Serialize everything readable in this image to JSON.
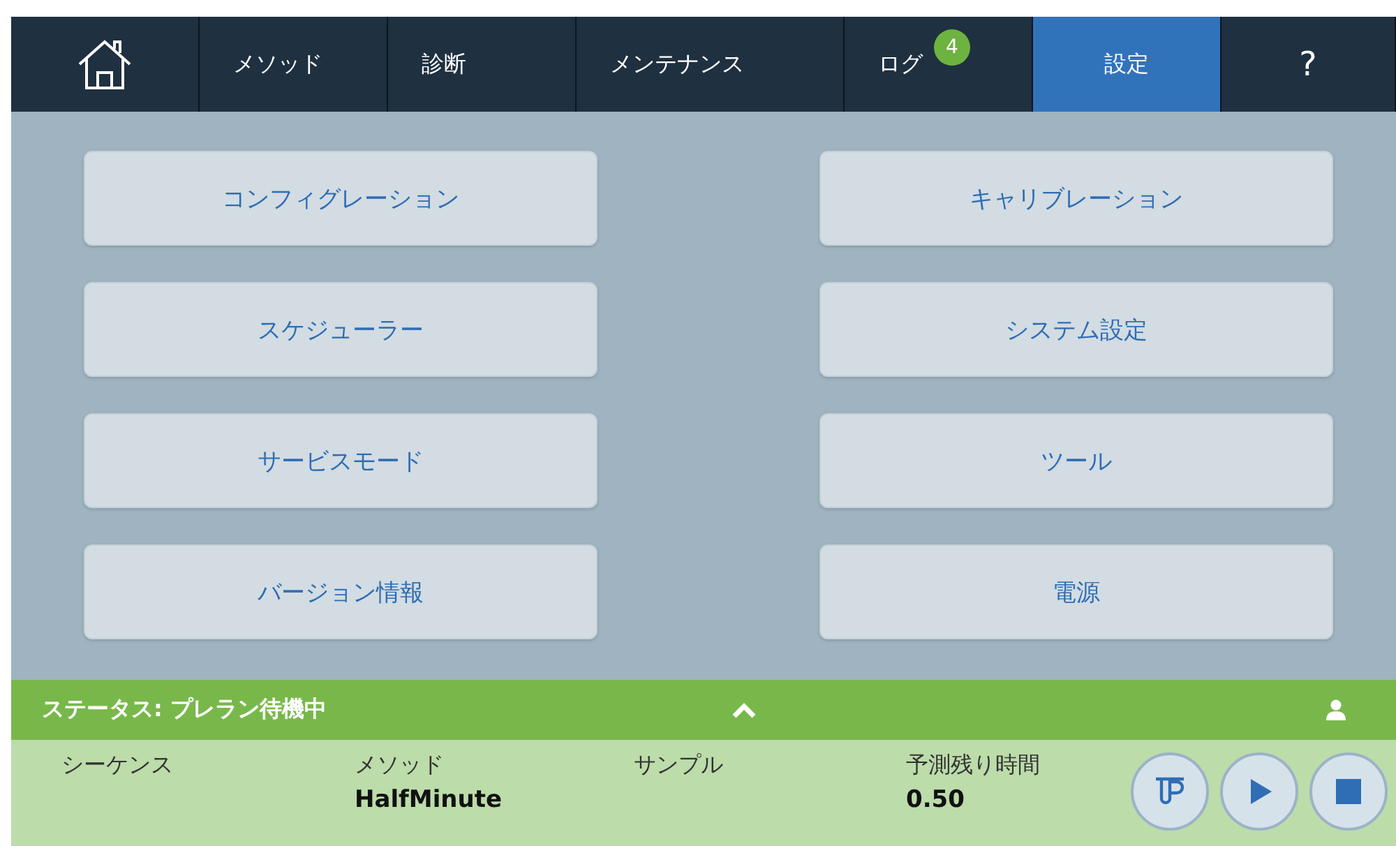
{
  "tabs": [
    {
      "kind": "home",
      "selected": false
    },
    {
      "kind": "text",
      "label": "メソッド",
      "selected": false
    },
    {
      "kind": "text",
      "label": "診断",
      "selected": false
    },
    {
      "kind": "text",
      "label": "メンテナンス",
      "selected": false
    },
    {
      "kind": "text",
      "label": "ログ",
      "badge": "4",
      "selected": false
    },
    {
      "kind": "text",
      "label": "設定",
      "selected": true
    },
    {
      "kind": "text",
      "label": "?",
      "selected": false
    }
  ],
  "menu_buttons": [
    {
      "label": "コンフィグレーション"
    },
    {
      "label": "キャリブレーション"
    },
    {
      "label": "スケジューラー"
    },
    {
      "label": "システム設定"
    },
    {
      "label": "サービスモード"
    },
    {
      "label": "ツール"
    },
    {
      "label": "バージョン情報"
    },
    {
      "label": "電源"
    }
  ],
  "status_bar": {
    "text": "ステータス: プレラン待機中"
  },
  "info": [
    {
      "label": "シーケンス"
    },
    {
      "label": "メソッド",
      "value": "HalfMinute"
    },
    {
      "label": "サンプル"
    },
    {
      "label": "予測残り時間",
      "value": "0.50"
    }
  ],
  "controls": [
    {
      "kind": "tube"
    },
    {
      "kind": "play"
    },
    {
      "kind": "stop"
    }
  ]
}
